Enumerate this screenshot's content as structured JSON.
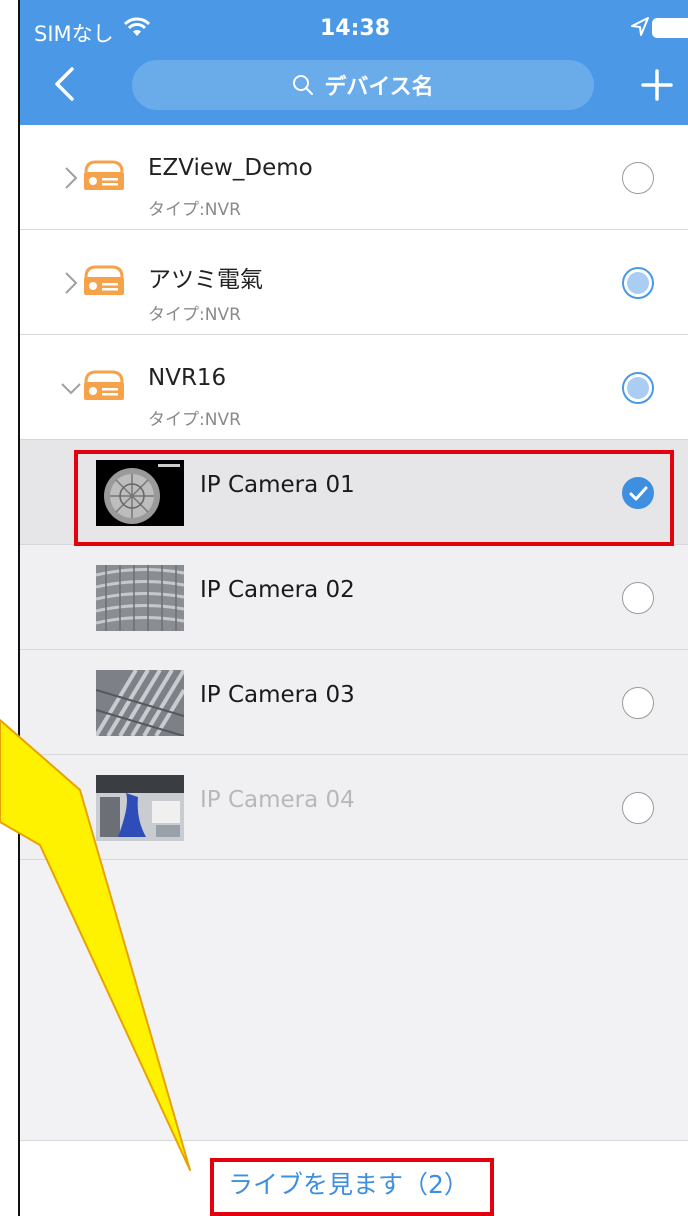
{
  "status_bar": {
    "carrier": "SIMなし",
    "time": "14:38"
  },
  "header": {
    "search_placeholder": "デバイス名"
  },
  "devices": [
    {
      "name": "EZView_Demo",
      "type": "タイプ:NVR",
      "state": "unchecked",
      "expanded": false
    },
    {
      "name": "アツミ電氣",
      "type": "タイプ:NVR",
      "state": "partial",
      "expanded": false
    },
    {
      "name": "NVR16",
      "type": "タイプ:NVR",
      "state": "partial",
      "expanded": true
    }
  ],
  "cameras": [
    {
      "name": "IP Camera 01",
      "state": "checked",
      "offline": false
    },
    {
      "name": "IP Camera 02",
      "state": "unchecked",
      "offline": false
    },
    {
      "name": "IP Camera 03",
      "state": "unchecked",
      "offline": false
    },
    {
      "name": "IP Camera 04",
      "state": "unchecked",
      "offline": true
    }
  ],
  "bottom": {
    "live_label": "ライブを見ます（2）"
  },
  "colors": {
    "accent": "#4a98e6",
    "highlight": "#e3000f",
    "callout": "#fff200"
  }
}
